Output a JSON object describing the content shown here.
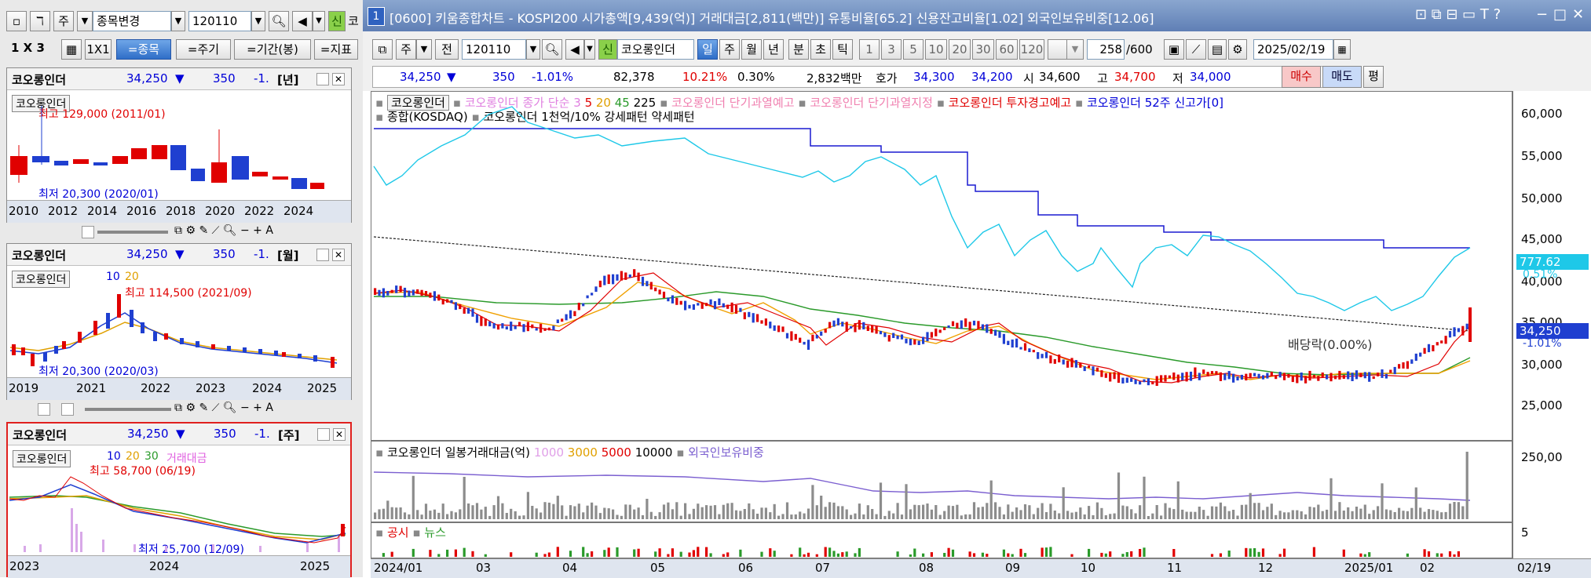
{
  "left": {
    "toolbar": {
      "mode": "주",
      "change_label": "종목변경",
      "code": "120110",
      "sin": "신",
      "cut": "코"
    },
    "row2": {
      "layout": "1 X 3",
      "one": "1X1",
      "stock": "=종목",
      "period": "=주기",
      "range": "=기간(봉)",
      "indicator": "=지표"
    },
    "panels": [
      {
        "name": "코오롱인더",
        "price": "34,250",
        "arrow": "▼",
        "change": "350",
        "rate": "-1.",
        "period": "[년]",
        "legend_name": "코오롱인더",
        "legend_extra": "",
        "high": "최고 129,000 (2011/01)",
        "low": "최저 20,300 (2020/01)",
        "xlabels": [
          "2010",
          "2012",
          "2014",
          "2016",
          "2018",
          "2020",
          "2022",
          "2024"
        ]
      },
      {
        "name": "코오롱인더",
        "price": "34,250",
        "arrow": "▼",
        "change": "350",
        "rate": "-1.",
        "period": "[월]",
        "legend_name": "코오롱인더",
        "ma": [
          "10",
          "20"
        ],
        "high": "최고 114,500 (2021/09)",
        "low": "최저 20,300 (2020/03)",
        "xlabels": [
          "2019",
          "2021",
          "2022",
          "2023",
          "2024",
          "2025"
        ]
      },
      {
        "name": "코오롱인더",
        "price": "34,250",
        "arrow": "▼",
        "change": "350",
        "rate": "-1.",
        "period": "[주]",
        "legend_name": "코오롱인더",
        "ma": [
          "10",
          "20",
          "30"
        ],
        "vol": "거래대금",
        "high": "최고 58,700 (06/19)",
        "low": "최저 25,700 (12/09)",
        "xlabels": [
          "2023",
          "2024",
          "2025"
        ]
      }
    ]
  },
  "main": {
    "title": "[0600] 키움종합차트 - KOSPI200 시가총액[9,439(억)] 거래대금[2,811(백만)] 유통비율[65.2] 신용잔고비율[1.02] 외국인보유비중[12.06]",
    "window_num": "1",
    "toolbar": {
      "mode": "주",
      "all": "전",
      "code": "120110",
      "sin": "신",
      "stock_name": "코오롱인더",
      "periods": [
        "일",
        "주",
        "월",
        "년",
        "분",
        "초",
        "틱"
      ],
      "active_period": "일",
      "nums": [
        "1",
        "3",
        "5",
        "10",
        "20",
        "30",
        "60",
        "120"
      ],
      "count": "258",
      "count_total": "/600",
      "date": "2025/02/19"
    },
    "quote": {
      "price": "34,250",
      "arrow": "▼",
      "change": "350",
      "rate": "-1.01%",
      "volume": "82,378",
      "vol_rate": "10.21%",
      "turnover": "0.30%",
      "amount": "2,832백만",
      "hoga_label": "호가",
      "ask": "34,300",
      "bid": "34,200",
      "open_label": "시",
      "open": "34,600",
      "high_label": "고",
      "high": "34,700",
      "low_label": "저",
      "low": "34,000",
      "buy": "매수",
      "sell": "매도",
      "flat": "평"
    },
    "legend": {
      "name_box": "코오롱인더",
      "price_line": "코오롱인더 종가 단순",
      "ma": [
        "3",
        "5",
        "20",
        "45",
        "225"
      ],
      "warn1": "코오롱인더 단기과열예고",
      "warn2": "코오롱인더 단기과열지정",
      "warn3": "코오롱인더 투자경고예고",
      "new_high": "코오롱인더 52주 신고가[0]",
      "line2_a": "종합(KOSDAQ)",
      "line2_b": "코오롱인더 1천억/10% 강세패턴",
      "line2_c": "약세패턴"
    },
    "annotation": "배당락(0.00%)",
    "yaxis": [
      "60,000",
      "55,000",
      "50,000",
      "45,000",
      "40,000",
      "35,000",
      "30,000",
      "25,000"
    ],
    "price_tag": "34,250",
    "price_tag2": "-1.01%",
    "kosdaq_tag": "777.62",
    "kosdaq_tag2": "0.51%",
    "vol_legend": {
      "title": "코오롱인더 일봉거래대금(억)",
      "levels": [
        "1000",
        "3000",
        "5000",
        "10000"
      ],
      "foreign": "외국인보유비중"
    },
    "vol_axis": "250,00",
    "news_legend": {
      "disclosure": "공시",
      "news": "뉴스"
    },
    "news_axis": "5",
    "xaxis": [
      "2024/01",
      "03",
      "04",
      "05",
      "06",
      "07",
      "08",
      "09",
      "10",
      "11",
      "12",
      "2025/01",
      "02",
      "02/19"
    ],
    "colors": {
      "up": "#e00000",
      "down": "#1f3fd0",
      "ma5": "#e00000",
      "ma20": "#f0a000",
      "ma45": "#2a9a2a",
      "kosdaq": "#1ec8e8",
      "newhigh": "#1a1ad0"
    }
  }
}
